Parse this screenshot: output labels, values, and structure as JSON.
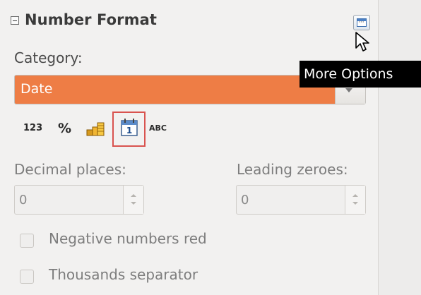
{
  "panel": {
    "title": "Number Format",
    "tooltip": "More Options",
    "category_label": "Category:",
    "category_value": "Date",
    "format_icons": [
      {
        "name": "number-format-icon",
        "text": "123"
      },
      {
        "name": "percent-format-icon",
        "text": "%"
      },
      {
        "name": "currency-format-icon",
        "text": ""
      },
      {
        "name": "date-format-icon",
        "text": "1"
      },
      {
        "name": "text-format-icon",
        "text": "ABC"
      }
    ],
    "selected_format": "date-format-icon",
    "decimal_places_label": "Decimal places:",
    "decimal_places_value": "0",
    "leading_zeroes_label": "Leading zeroes:",
    "leading_zeroes_value": "0",
    "negative_red_label": "Negative numbers red",
    "negative_red_checked": false,
    "thousands_sep_label": "Thousands separator",
    "thousands_sep_checked": false
  },
  "colors": {
    "accent": "#ee7d45",
    "selection_border": "#d9534f",
    "tooltip_bg": "#000000"
  }
}
